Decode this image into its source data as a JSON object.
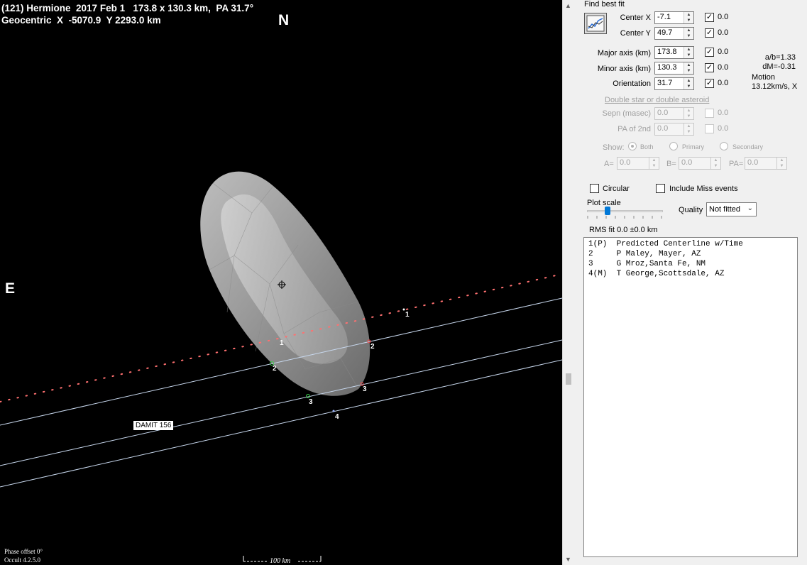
{
  "plot": {
    "title_line1": "(121) Hermione  2017 Feb 1   173.8 x 130.3 km,  PA 31.7°",
    "title_line2": "Geocentric  X  -5070.9  Y 2293.0 km",
    "north": "N",
    "east": "E",
    "phase_offset": "Phase offset 0°",
    "version": "Occult 4.2.5.0",
    "scale_label": "100 km",
    "shape_model_label": "DAMIT 156",
    "chord_labels": [
      "1",
      "2",
      "2",
      "3",
      "3",
      "4",
      "1"
    ],
    "colors": {
      "background": "#000000",
      "chord": "#c8d8ee",
      "track": "#ff7070",
      "disappear": "#3ad04a",
      "reappear": "#ff4a4a",
      "miss": "#9fb8ff"
    }
  },
  "panel": {
    "group_title": "Find best fit",
    "fit_button_icon": "fit-chart-icon",
    "center_x": {
      "label": "Center X",
      "value": "-7.1",
      "checked": true,
      "check_value": "0.0"
    },
    "center_y": {
      "label": "Center Y",
      "value": "49.7",
      "checked": true,
      "check_value": "0.0"
    },
    "major_axis": {
      "label": "Major axis (km)",
      "value": "173.8",
      "checked": true,
      "check_value": "0.0"
    },
    "minor_axis": {
      "label": "Minor axis (km)",
      "value": "130.3",
      "checked": true,
      "check_value": "0.0"
    },
    "orientation": {
      "label": "Orientation",
      "value": "31.7",
      "checked": true,
      "check_value": "0.0"
    },
    "ratio_ab": "a/b=1.33",
    "dm": "dM=-0.31",
    "motion_label": "Motion",
    "motion_value": "13.12km/s, X",
    "double_star_link": "Double star  or  double asteroid",
    "sepn": {
      "label": "Sepn (masec)",
      "value": "0.0",
      "check_value": "0.0"
    },
    "pa2": {
      "label": "PA of 2nd",
      "value": "0.0",
      "check_value": "0.0"
    },
    "show_label": "Show:",
    "show_options": [
      "Both",
      "Primary",
      "Secondary"
    ],
    "a_label": "A=",
    "a_value": "0.0",
    "b_label": "B=",
    "b_value": "0.0",
    "pa_label": "PA=",
    "pa_value": "0.0",
    "circular_label": "Circular",
    "include_miss_label": "Include Miss events",
    "plot_scale_label": "Plot scale",
    "quality_label": "Quality",
    "quality_value": "Not fitted",
    "rms_fit": "RMS fit  0.0 ±0.0 km",
    "events": [
      "1(P)  Predicted Centerline w/Time",
      "2     P Maley, Mayer, AZ",
      "3     G Mroz,Santa Fe, NM",
      "4(M)  T George,Scottsdale, AZ"
    ]
  }
}
